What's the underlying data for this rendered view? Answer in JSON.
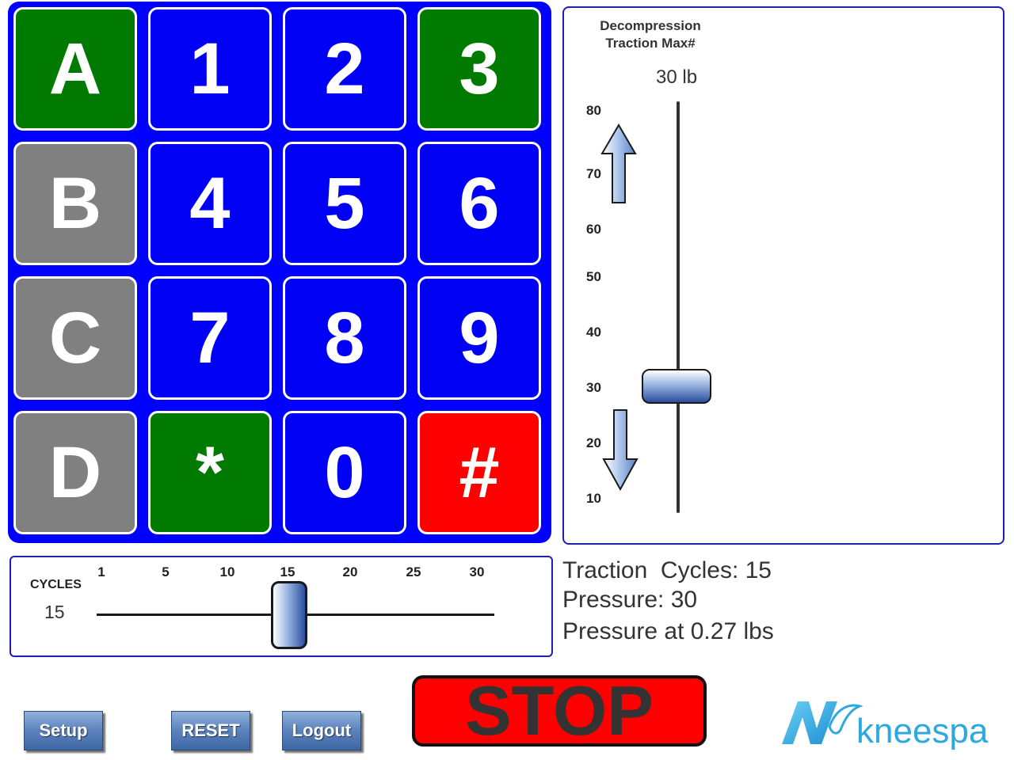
{
  "keypad": {
    "keys": [
      {
        "label": "A",
        "color": "#007a00"
      },
      {
        "label": "1",
        "color": "#0000f5"
      },
      {
        "label": "2",
        "color": "#0000f5"
      },
      {
        "label": "3",
        "color": "#007a00"
      },
      {
        "label": "B",
        "color": "#808080"
      },
      {
        "label": "4",
        "color": "#0000f5"
      },
      {
        "label": "5",
        "color": "#0000f5"
      },
      {
        "label": "6",
        "color": "#0000f5"
      },
      {
        "label": "C",
        "color": "#808080"
      },
      {
        "label": "7",
        "color": "#0000f5"
      },
      {
        "label": "8",
        "color": "#0000f5"
      },
      {
        "label": "9",
        "color": "#0000f5"
      },
      {
        "label": "D",
        "color": "#808080"
      },
      {
        "label": "*",
        "color": "#007a00"
      },
      {
        "label": "0",
        "color": "#0000f5"
      },
      {
        "label": "#",
        "color": "#ff0000"
      }
    ]
  },
  "decompression": {
    "title_line1": "Decompression",
    "title_line2": "Traction Max#",
    "value_display": "30 lb",
    "value": 30,
    "ticks": [
      "80",
      "70",
      "60",
      "50",
      "40",
      "30",
      "20",
      "10"
    ],
    "up_icon": "arrow-up-icon",
    "down_icon": "arrow-down-icon"
  },
  "cycles": {
    "label": "CYCLES",
    "value": "15",
    "ticks": [
      "1",
      "5",
      "10",
      "15",
      "20",
      "25",
      "30"
    ]
  },
  "status": {
    "traction_cycles": "Traction  Cycles: 15",
    "pressure": "Pressure: 30",
    "pressure_at": "Pressure at 0.27 lbs"
  },
  "buttons": {
    "setup": "Setup",
    "reset": "RESET",
    "logout": "Logout",
    "stop": "STOP"
  },
  "logo": {
    "text": "kneespa",
    "color": "#2ea8e0"
  }
}
